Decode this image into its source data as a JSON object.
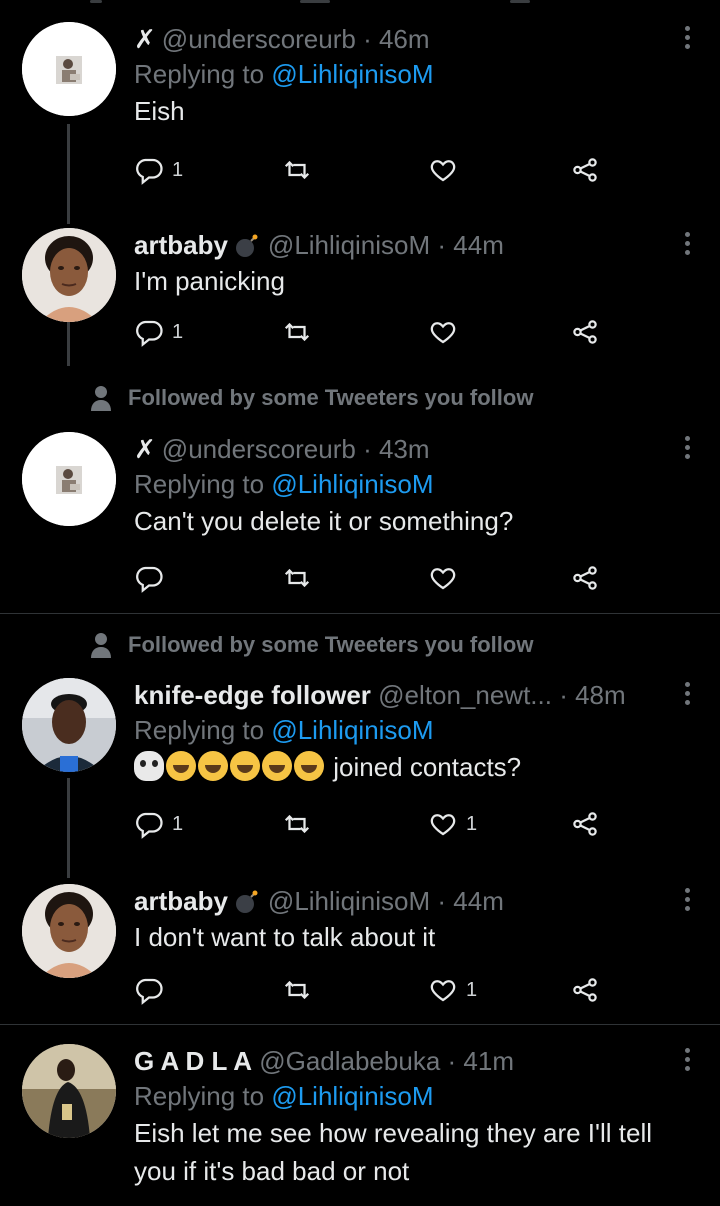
{
  "tweets": [
    {
      "name": "",
      "handle": "@underscoreurb",
      "time": "· 46m",
      "replying_prefix": "Replying to ",
      "replying_to": "@LihliqinisoM",
      "text": "Eish",
      "counts": {
        "reply": "1",
        "retweet": "",
        "like": ""
      },
      "avatar": "avatar-image-small-figure"
    },
    {
      "name": "artbaby",
      "handle": "@LihliqinisoM",
      "time": "· 44m",
      "text": "I'm panicking",
      "counts": {
        "reply": "1",
        "retweet": "",
        "like": ""
      },
      "avatar": "avatar-photo-woman"
    },
    {
      "social": "Followed by some Tweeters you follow",
      "name": "",
      "handle": "@underscoreurb",
      "time": "· 43m",
      "replying_prefix": "Replying to ",
      "replying_to": "@LihliqinisoM",
      "text": "Can't you delete it or something?",
      "counts": {
        "reply": "",
        "retweet": "",
        "like": ""
      },
      "avatar": "avatar-image-small-figure"
    },
    {
      "social": "Followed by some Tweeters you follow",
      "name": "knife-edge follower",
      "handle": "@elton_newt...",
      "time": "· 48m",
      "replying_prefix": "Replying to ",
      "replying_to": "@LihliqinisoM",
      "text": "joined contacts?",
      "counts": {
        "reply": "1",
        "retweet": "",
        "like": "1"
      },
      "avatar": "avatar-photo-man"
    },
    {
      "name": "artbaby",
      "handle": "@LihliqinisoM",
      "time": "· 44m",
      "text": "I don't want to talk about it",
      "counts": {
        "reply": "",
        "retweet": "",
        "like": "1"
      },
      "avatar": "avatar-photo-woman"
    },
    {
      "name": "G A D L A",
      "handle": "@Gadlabebuka",
      "time": "· 41m",
      "replying_prefix": "Replying to ",
      "replying_to": "@LihliqinisoM",
      "text": "Eish let me see how revealing they are I'll tell you if it's bad bad or not",
      "counts": {
        "reply": "",
        "retweet": "",
        "like": ""
      },
      "avatar": "avatar-photo-man-outdoors"
    }
  ],
  "icons": {
    "x_mark": "✗",
    "reply": "reply-icon",
    "retweet": "retweet-icon",
    "like": "heart-icon",
    "share": "share-icon",
    "more": "more-vertical-icon",
    "person": "person-icon"
  },
  "colors": {
    "background": "#000000",
    "text": "#e7e9ea",
    "secondary": "#71767b",
    "link": "#1d9bf0",
    "divider": "#2f3336"
  }
}
